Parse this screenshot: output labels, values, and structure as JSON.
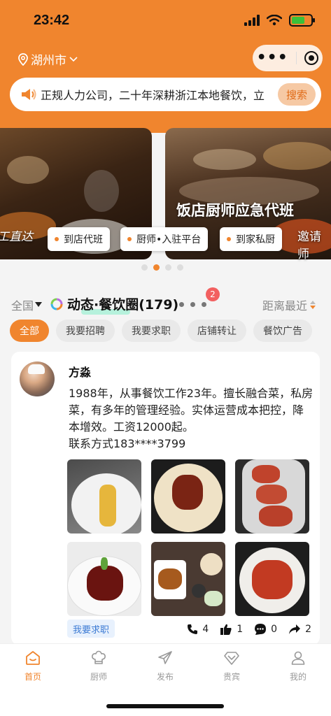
{
  "status": {
    "time": "23:42"
  },
  "header": {
    "city": "湖州市",
    "notice": "正规人力公司，二十年深耕浙江本地餐饮，立",
    "search_button": "搜索"
  },
  "banner": {
    "title": "饭店厨师应急代班",
    "left_slogan": "工直达",
    "right_slogan": "邀请师",
    "chips": [
      "到店代班",
      "厨师•入驻平台",
      "到家私厨"
    ],
    "slides": 4,
    "active_slide": 1
  },
  "feed": {
    "region": "全国",
    "title": "动态·餐饮圈(179)",
    "badge": "2",
    "sort": "距离最近",
    "tabs": [
      "全部",
      "我要招聘",
      "我要求职",
      "店铺转让",
      "餐饮广告"
    ]
  },
  "post": {
    "author": "方淼",
    "text": "1988年，从事餐饮工作23年。擅长融合菜，私房菜，有多年的管理经验。实体运营成本把控，降本增效。工资12000起。",
    "contact": "联系方式183****3799",
    "tag": "我要求职",
    "calls": "4",
    "likes": "1",
    "comments": "0",
    "shares": "2",
    "photos": [
      "dumpling-dish",
      "braised-meat",
      "abalone-dish",
      "braised-pork",
      "set-meal",
      "shrimp-dish"
    ]
  },
  "tabbar": {
    "items": [
      {
        "label": "首页",
        "icon": "home-icon"
      },
      {
        "label": "厨师",
        "icon": "chef-hat-icon"
      },
      {
        "label": "发布",
        "icon": "send-icon"
      },
      {
        "label": "贵宾",
        "icon": "diamond-icon"
      },
      {
        "label": "我的",
        "icon": "user-icon"
      }
    ]
  },
  "colors": {
    "accent": "#f0852e",
    "badge": "#f26060",
    "tag_text": "#3d7bd4"
  }
}
